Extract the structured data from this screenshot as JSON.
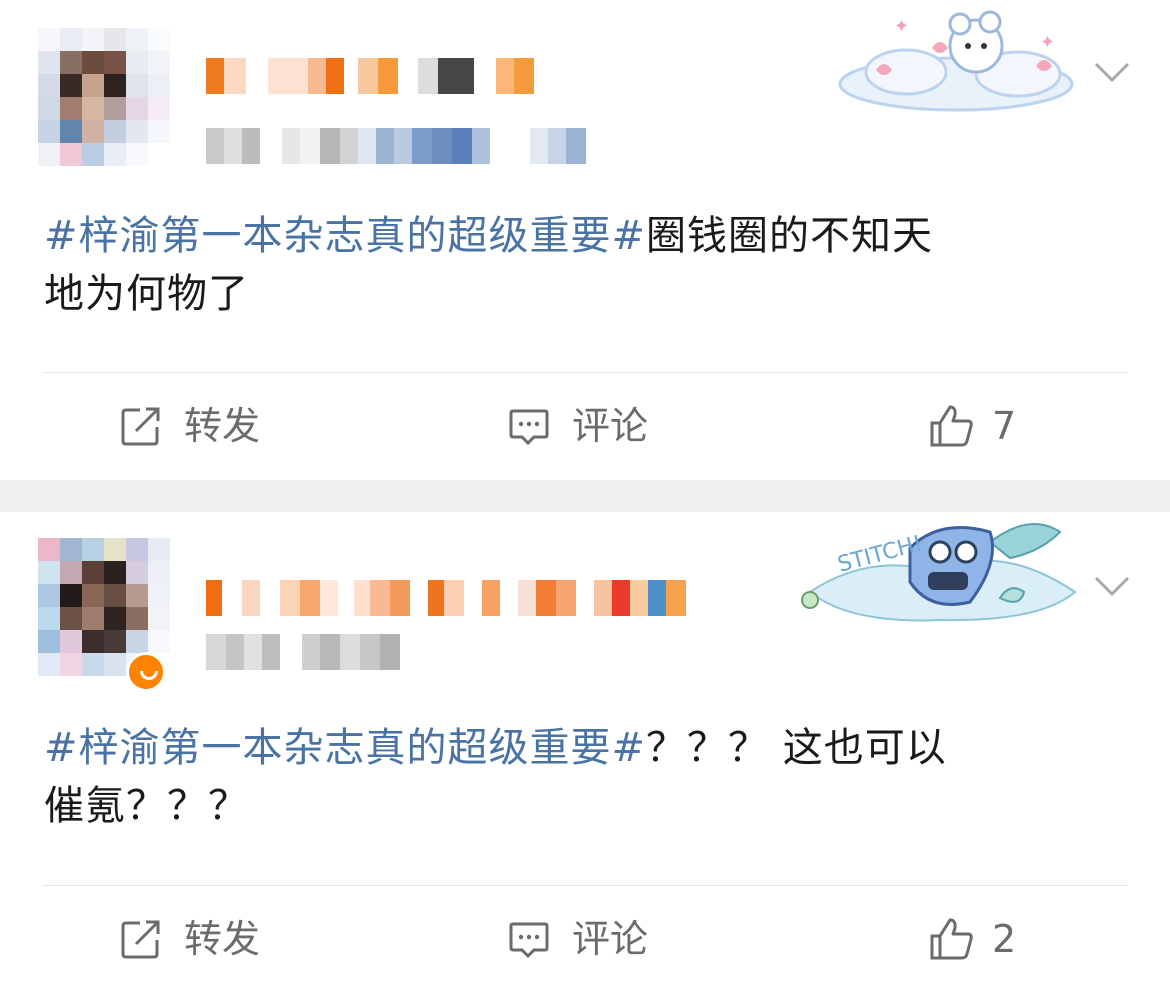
{
  "feed": {
    "posts": [
      {
        "topic": "#梓渝第一本杂志真的超级重要#",
        "text_line1": "圈钱圈的不知天",
        "text_line2": "地为何物了",
        "actions": {
          "repost": "转发",
          "comment": "评论",
          "like_count": "7"
        }
      },
      {
        "topic": "#梓渝第一本杂志真的超级重要#",
        "text_line1": "？？？ 这也可以",
        "text_line2": "催氪？？？",
        "actions": {
          "repost": "转发",
          "comment": "评论",
          "like_count": "2"
        }
      }
    ]
  },
  "icons": {
    "repost": "repost-icon",
    "comment": "comment-icon",
    "like": "thumbs-up-icon",
    "menu": "chevron-down-icon"
  },
  "colors": {
    "topic": "#4a73a5",
    "action_text": "#6b6b6b",
    "separator": "#efefef",
    "badge": "#ff8200"
  }
}
